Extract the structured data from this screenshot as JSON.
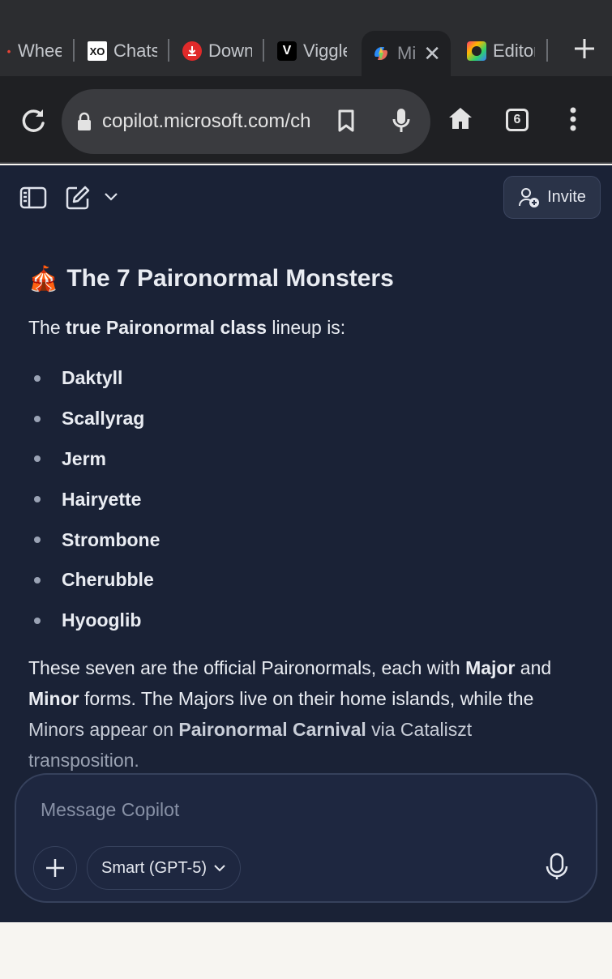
{
  "browser": {
    "tabs": [
      {
        "label": "Whee",
        "icon": "wheel-favicon"
      },
      {
        "label": "Chats",
        "icon": "xo-favicon"
      },
      {
        "label": "Down",
        "icon": "download-favicon"
      },
      {
        "label": "Viggle",
        "icon": "viggle-favicon"
      },
      {
        "label": "Mi",
        "icon": "copilot-favicon",
        "active": true
      },
      {
        "label": "Editor",
        "icon": "editor-favicon"
      }
    ],
    "xo_favicon_text": "XO",
    "url": "copilot.microsoft.com/ch",
    "tab_count": "6"
  },
  "app": {
    "invite_label": "Invite",
    "message": {
      "emoji": "🎪",
      "title": "The 7 Paironormal Monsters",
      "intro_pre": "The ",
      "intro_bold": "true Paironormal class",
      "intro_post": " lineup is:",
      "monsters": [
        "Daktyll",
        "Scallyrag",
        "Jerm",
        "Hairyette",
        "Strombone",
        "Cherubble",
        "Hyooglib"
      ],
      "summary_1": "These seven are the official Paironormals, each with ",
      "summary_major": "Major",
      "summary_2": " and ",
      "summary_minor": "Minor",
      "summary_3": " forms. The Majors live on their home islands, while the ",
      "summary_4": "Minors appear on ",
      "summary_carnival": "Paironormal Carnival",
      "summary_5": " via Cataliszt ",
      "summary_6": "transposition."
    },
    "composer": {
      "placeholder": "Message Copilot",
      "model_label": "Smart (GPT-5)"
    }
  },
  "colors": {
    "app_background": "#1a2236",
    "browser_chrome": "#1f2023",
    "tab_strip": "#2c2d30"
  }
}
